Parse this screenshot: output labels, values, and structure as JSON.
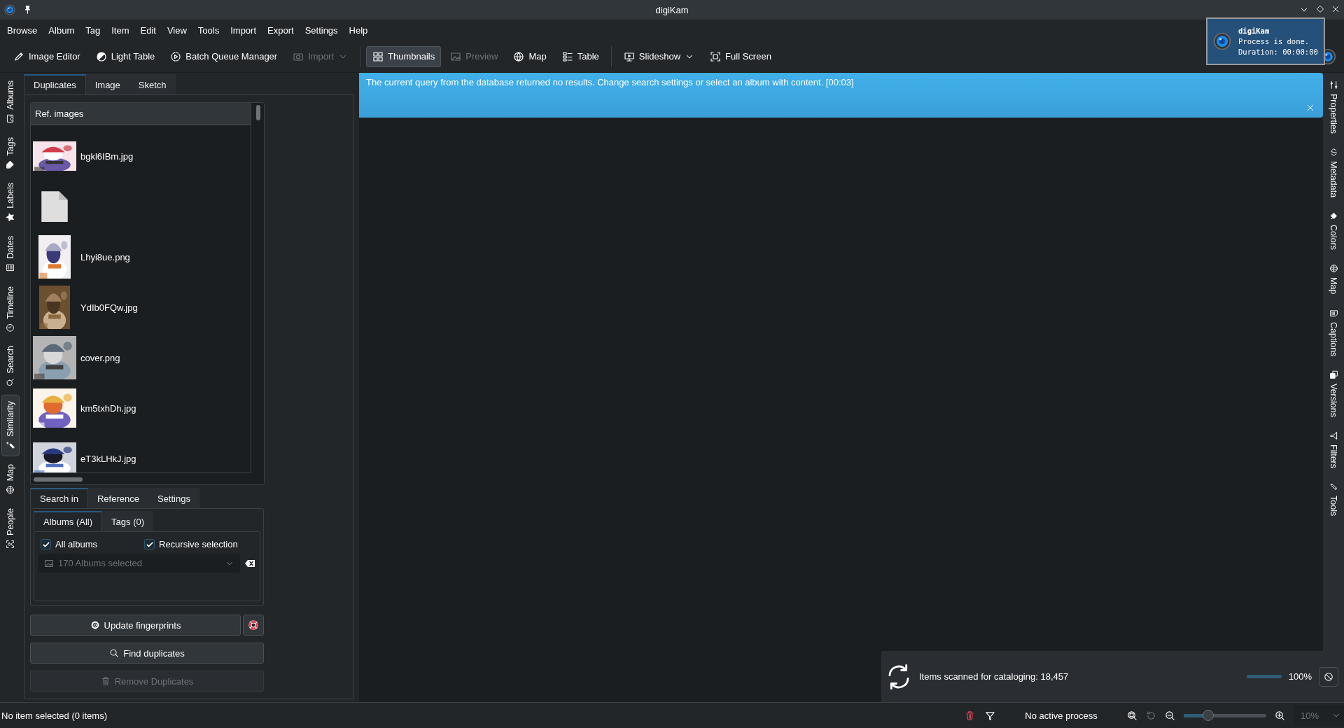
{
  "window": {
    "title": "digiKam"
  },
  "menu": [
    "Browse",
    "Album",
    "Tag",
    "Item",
    "Edit",
    "View",
    "Tools",
    "Import",
    "Export",
    "Settings",
    "Help"
  ],
  "toolbar": {
    "groups": [
      {
        "items": [
          {
            "label": "Image Editor",
            "disabled": false,
            "dropdown": false
          },
          {
            "label": "Light Table",
            "disabled": false,
            "dropdown": false
          },
          {
            "label": "Batch Queue Manager",
            "disabled": false,
            "dropdown": false
          },
          {
            "label": "Import",
            "disabled": true,
            "dropdown": true
          }
        ]
      },
      {
        "items": [
          {
            "label": "Thumbnails",
            "disabled": false,
            "selected": true
          },
          {
            "label": "Preview",
            "disabled": true,
            "selected": false
          },
          {
            "label": "Map",
            "disabled": false,
            "selected": false
          },
          {
            "label": "Table",
            "disabled": false,
            "selected": false
          }
        ]
      },
      {
        "items": [
          {
            "label": "Slideshow",
            "disabled": false,
            "dropdown": true
          },
          {
            "label": "Full Screen",
            "disabled": false,
            "dropdown": false
          }
        ]
      }
    ]
  },
  "notification": {
    "app": "digiKam",
    "lines": [
      "Process is done.",
      "Duration: 00:00:00"
    ]
  },
  "left_tabs": [
    {
      "label": "Albums",
      "selected": false
    },
    {
      "label": "Tags",
      "selected": false
    },
    {
      "label": "Labels",
      "selected": false
    },
    {
      "label": "Dates",
      "selected": false
    },
    {
      "label": "Timeline",
      "selected": false
    },
    {
      "label": "Search",
      "selected": false
    },
    {
      "label": "Similarity",
      "selected": true
    },
    {
      "label": "Map",
      "selected": false
    },
    {
      "label": "People",
      "selected": false
    }
  ],
  "similarity": {
    "tabs": [
      {
        "label": "Duplicates",
        "selected": true
      },
      {
        "label": "Image",
        "selected": false
      },
      {
        "label": "Sketch",
        "selected": false
      }
    ],
    "ref_images": {
      "header": "Ref. images",
      "items": [
        {
          "kind": "picture",
          "name": "bgkl6IBm.jpg"
        },
        {
          "kind": "file"
        },
        {
          "kind": "picture",
          "name": "Lhyi8ue.png"
        },
        {
          "kind": "picture",
          "name": "YdIb0FQw.jpg"
        },
        {
          "kind": "picture",
          "name": "cover.png"
        },
        {
          "kind": "picture",
          "name": "km5txhDh.jpg"
        },
        {
          "kind": "picture",
          "name": "eT3kLHkJ.jpg"
        }
      ]
    },
    "search_tabs": [
      {
        "label": "Search in",
        "selected": true
      },
      {
        "label": "Reference",
        "selected": false
      },
      {
        "label": "Settings",
        "selected": false
      }
    ],
    "scope_tabs": [
      {
        "label": "Albums (All)",
        "selected": true
      },
      {
        "label": "Tags (0)",
        "selected": false
      }
    ],
    "checkboxes": [
      {
        "label": "All albums",
        "checked": true
      },
      {
        "label": "Recursive selection",
        "checked": true
      }
    ],
    "album_selector": {
      "value": "170 Albums selected",
      "disabled": true
    },
    "buttons": [
      {
        "label": "Update fingerprints",
        "disabled": false
      },
      {
        "label": "Find duplicates",
        "disabled": false
      },
      {
        "label": "Remove Duplicates",
        "disabled": true
      }
    ]
  },
  "banner": {
    "message": "The current query from the database returned no results. Change search settings or select an album with content. [00:03]"
  },
  "right_tabs": [
    {
      "label": "Properties",
      "selected": false
    },
    {
      "label": "Metadata",
      "selected": false
    },
    {
      "label": "Colors",
      "selected": false
    },
    {
      "label": "Map",
      "selected": false
    },
    {
      "label": "Captions",
      "selected": false
    },
    {
      "label": "Versions",
      "selected": false
    },
    {
      "label": "Filters",
      "selected": false
    },
    {
      "label": "Tools",
      "selected": false
    }
  ],
  "progress": {
    "text": "Items scanned for cataloging: 18,457",
    "level": 1,
    "reading": "100%"
  },
  "status_bar": {
    "selection": "No item selected (0 items)",
    "process": "No active process",
    "zoom": {
      "level": 0.3,
      "value": "10%"
    }
  }
}
